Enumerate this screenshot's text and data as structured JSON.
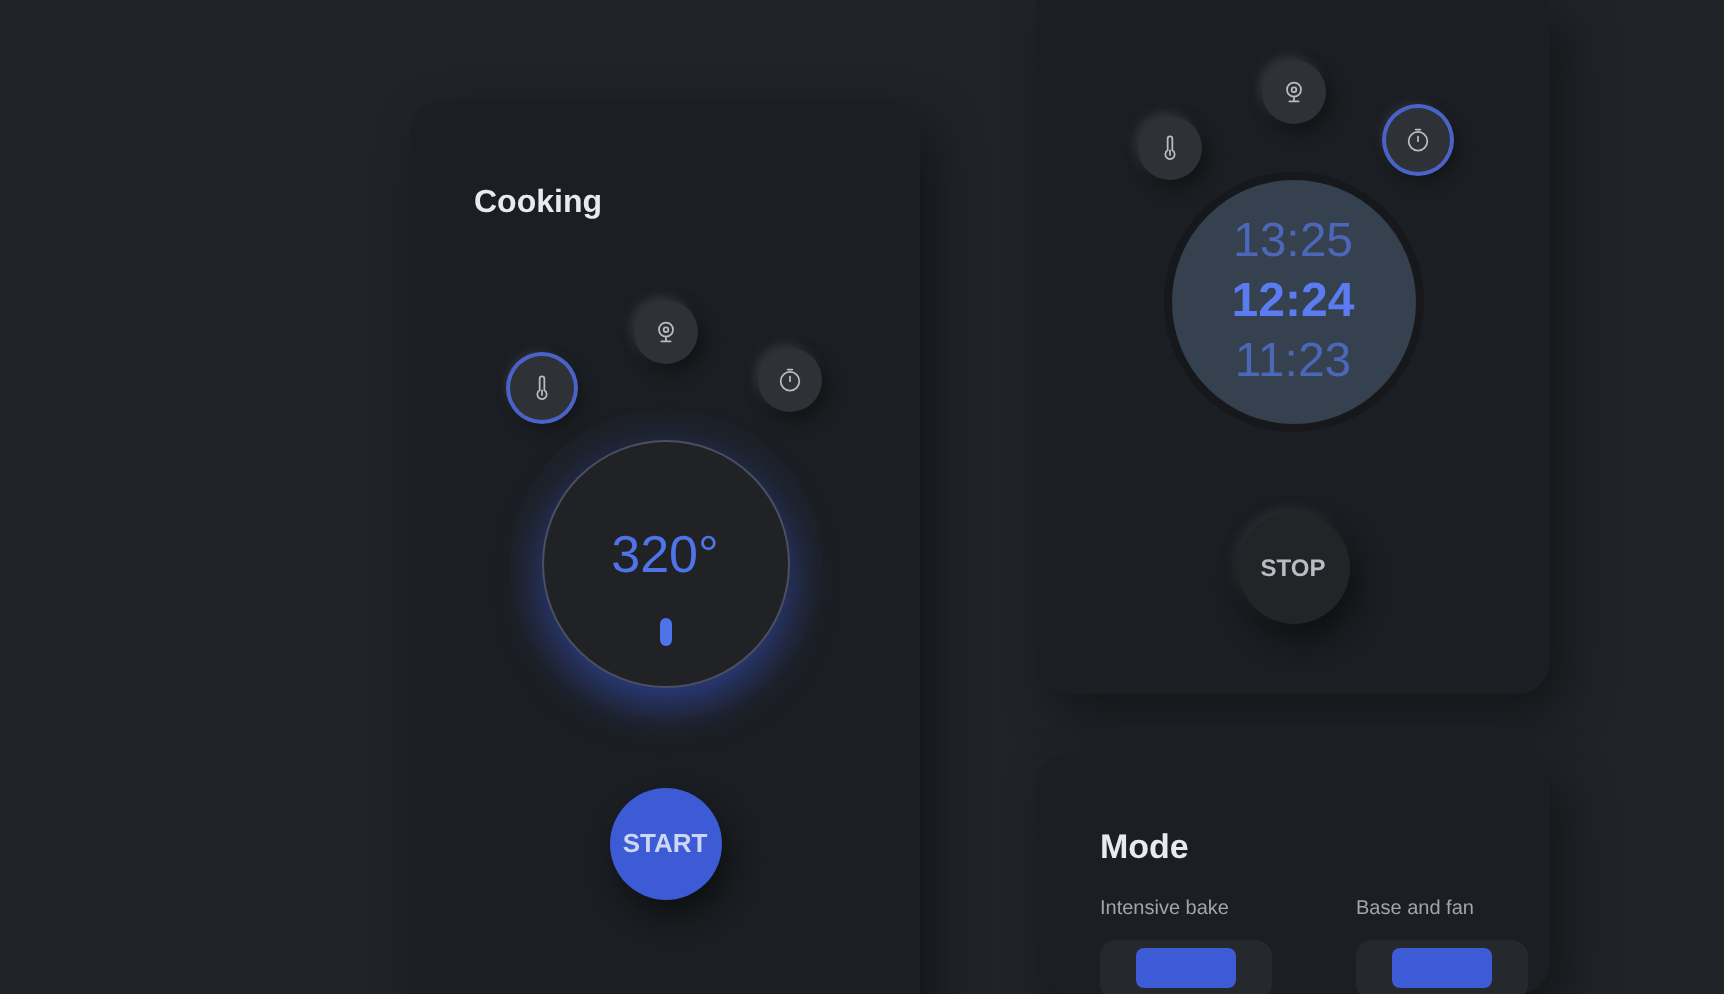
{
  "cooking": {
    "title": "Cooking",
    "modes": [
      {
        "kind": "thermometer",
        "selected": true
      },
      {
        "kind": "webcam",
        "selected": false
      },
      {
        "kind": "timer",
        "selected": false
      }
    ],
    "temperature": "320°",
    "action": "START"
  },
  "timer": {
    "modes": [
      {
        "kind": "thermometer",
        "selected": false
      },
      {
        "kind": "webcam",
        "selected": false
      },
      {
        "kind": "timer",
        "selected": true
      }
    ],
    "times": [
      {
        "label": "13:25",
        "selected": false
      },
      {
        "label": "12:24",
        "selected": true
      },
      {
        "label": "11:23",
        "selected": false
      }
    ],
    "action": "STOP"
  },
  "mode": {
    "title": "Mode",
    "options": [
      {
        "label": "Intensive bake"
      },
      {
        "label": "Base and fan"
      }
    ]
  }
}
